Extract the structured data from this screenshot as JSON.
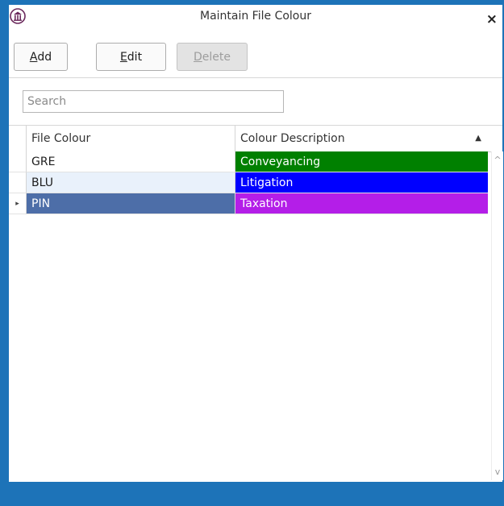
{
  "window": {
    "title": "Maintain File Colour",
    "close_glyph": "×"
  },
  "toolbar": {
    "add": {
      "mnemonic": "A",
      "rest": "dd"
    },
    "edit": {
      "mnemonic": "E",
      "rest": "dit"
    },
    "delete": {
      "mnemonic": "D",
      "rest": "elete",
      "disabled": true
    }
  },
  "search": {
    "placeholder": "Search",
    "value": ""
  },
  "grid": {
    "columns": [
      "File Colour",
      "Colour Description"
    ],
    "sort_indicator": "▲",
    "rows": [
      {
        "code": "GRE",
        "description": "Conveyancing",
        "color": "#008000",
        "selected": false
      },
      {
        "code": "BLU",
        "description": "Litigation",
        "color": "#0000ff",
        "selected": false
      },
      {
        "code": "PIN",
        "description": "Taxation",
        "color": "#b41ee8",
        "selected": true
      }
    ],
    "current_row_glyph": "▸",
    "scroll_up": "^",
    "scroll_down": "v"
  },
  "colors": {
    "frame": "#1d73b8",
    "selected_row": "#4d6ea8",
    "hover_row": "#e9f1fb"
  }
}
